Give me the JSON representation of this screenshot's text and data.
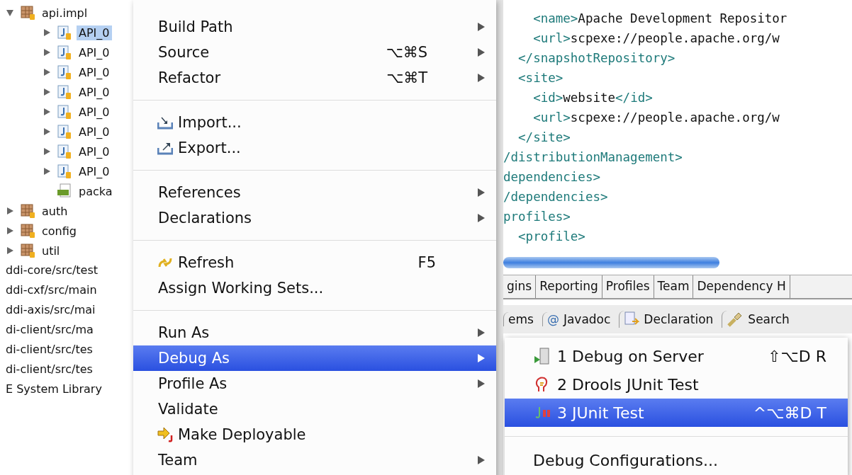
{
  "tree": [
    {
      "label": "api.impl",
      "kind": "package",
      "expanded": true,
      "selected": false,
      "children": [
        {
          "label": "API_0",
          "kind": "java",
          "expanded": false,
          "selected": true
        },
        {
          "label": "API_0",
          "kind": "java",
          "expanded": false,
          "selected": false
        },
        {
          "label": "API_0",
          "kind": "java",
          "expanded": false,
          "selected": false
        },
        {
          "label": "API_0",
          "kind": "java",
          "expanded": false,
          "selected": false
        },
        {
          "label": "API_0",
          "kind": "java",
          "expanded": false,
          "selected": false
        },
        {
          "label": "API_0",
          "kind": "java",
          "expanded": false,
          "selected": false
        },
        {
          "label": "API_0",
          "kind": "java",
          "expanded": false,
          "selected": false
        },
        {
          "label": "API_0",
          "kind": "java",
          "expanded": false,
          "selected": false
        },
        {
          "label": "packa",
          "kind": "html",
          "selected": false
        }
      ]
    },
    {
      "label": "auth",
      "kind": "package",
      "expanded": false,
      "selected": false
    },
    {
      "label": "config",
      "kind": "package",
      "expanded": false,
      "selected": false
    },
    {
      "label": "util",
      "kind": "package",
      "expanded": false,
      "selected": false
    }
  ],
  "source_folders": [
    "ddi-core/src/test",
    "ddi-cxf/src/main",
    "ddi-axis/src/mai",
    "di-client/src/ma",
    "di-client/src/tes",
    "di-client/src/tes",
    "E System Library"
  ],
  "editor": {
    "lines": [
      "    <name>Apache Development Repositor",
      "    <url>scpexe://people.apache.org/w",
      "  </snapshotRepository>",
      "  <site>",
      "    <id>website</id>",
      "    <url>scpexe://people.apache.org/w",
      "  </site>",
      "/distributionManagement>",
      "dependencies>",
      "/dependencies>",
      "profiles>",
      "  <profile>"
    ],
    "page_tabs": [
      "gins",
      "Reporting",
      "Profiles",
      "Team",
      "Dependency H"
    ]
  },
  "views": [
    {
      "kind": "plain",
      "label": "ems"
    },
    {
      "kind": "symbol",
      "symbol": "@",
      "label": "Javadoc"
    },
    {
      "kind": "declaration",
      "label": "Declaration"
    },
    {
      "kind": "search",
      "label": "Search"
    }
  ],
  "context_menu": [
    {
      "kind": "plain",
      "label": "Build Path",
      "submenu": true,
      "selected": false
    },
    {
      "kind": "plain",
      "label": "Source",
      "shortcut": "⌥⌘S",
      "submenu": true,
      "selected": false
    },
    {
      "kind": "plain",
      "label": "Refactor",
      "shortcut": "⌥⌘T",
      "submenu": true,
      "selected": false
    },
    {
      "kind": "separator"
    },
    {
      "kind": "import",
      "label": "Import...",
      "submenu": false,
      "selected": false
    },
    {
      "kind": "export",
      "label": "Export...",
      "submenu": false,
      "selected": false
    },
    {
      "kind": "separator"
    },
    {
      "kind": "plain",
      "label": "References",
      "submenu": true,
      "selected": false
    },
    {
      "kind": "plain",
      "label": "Declarations",
      "submenu": true,
      "selected": false
    },
    {
      "kind": "separator"
    },
    {
      "kind": "refresh",
      "label": "Refresh",
      "shortcut": "F5",
      "submenu": false,
      "selected": false
    },
    {
      "kind": "plain",
      "label": "Assign Working Sets...",
      "submenu": false,
      "selected": false
    },
    {
      "kind": "separator"
    },
    {
      "kind": "plain",
      "label": "Run As",
      "submenu": true,
      "selected": false
    },
    {
      "kind": "plain",
      "label": "Debug As",
      "submenu": true,
      "selected": true
    },
    {
      "kind": "plain",
      "label": "Profile As",
      "submenu": true,
      "selected": false
    },
    {
      "kind": "plain",
      "label": "Validate",
      "submenu": false,
      "selected": false
    },
    {
      "kind": "deploy",
      "label": "Make Deployable",
      "submenu": false,
      "selected": false
    },
    {
      "kind": "plain",
      "label": "Team",
      "submenu": true,
      "selected": false
    }
  ],
  "submenu": [
    {
      "kind": "server",
      "label": "1 Debug on Server",
      "shortcut": "⇧⌥D R",
      "selected": false
    },
    {
      "kind": "drools",
      "label": "2 Drools JUnit Test",
      "selected": false
    },
    {
      "kind": "junit",
      "label": "3 JUnit Test",
      "shortcut": "^⌥⌘D T",
      "selected": true
    },
    {
      "kind": "separator"
    },
    {
      "kind": "plain",
      "label": "Debug Configurations...",
      "selected": false
    }
  ]
}
